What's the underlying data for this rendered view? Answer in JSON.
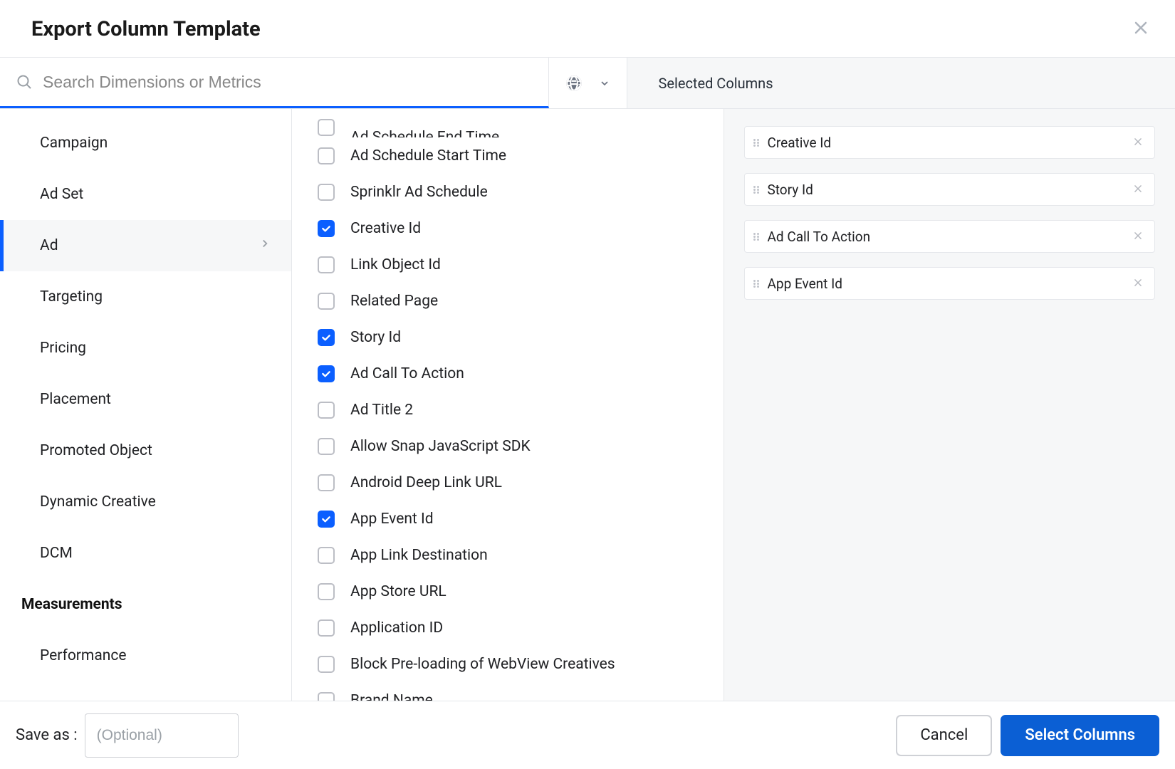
{
  "header": {
    "title": "Export Column Template"
  },
  "search": {
    "placeholder": "Search Dimensions or Metrics"
  },
  "selected_header": "Selected Columns",
  "sidebar": {
    "items": [
      {
        "label": "Campaign",
        "active": false
      },
      {
        "label": "Ad Set",
        "active": false
      },
      {
        "label": "Ad",
        "active": true
      },
      {
        "label": "Targeting",
        "active": false
      },
      {
        "label": "Pricing",
        "active": false
      },
      {
        "label": "Placement",
        "active": false
      },
      {
        "label": "Promoted Object",
        "active": false
      },
      {
        "label": "Dynamic Creative",
        "active": false
      },
      {
        "label": "DCM",
        "active": false
      }
    ],
    "section2": {
      "header": "Measurements",
      "items": [
        {
          "label": "Performance"
        }
      ]
    }
  },
  "options": [
    {
      "label": "Ad Schedule End Time",
      "checked": false,
      "cutoff": true
    },
    {
      "label": "Ad Schedule Start Time",
      "checked": false
    },
    {
      "label": "Sprinklr Ad Schedule",
      "checked": false
    },
    {
      "label": "Creative Id",
      "checked": true
    },
    {
      "label": "Link Object Id",
      "checked": false
    },
    {
      "label": "Related Page",
      "checked": false
    },
    {
      "label": "Story Id",
      "checked": true
    },
    {
      "label": "Ad Call To Action",
      "checked": true
    },
    {
      "label": "Ad Title 2",
      "checked": false
    },
    {
      "label": "Allow Snap JavaScript SDK",
      "checked": false
    },
    {
      "label": "Android Deep Link URL",
      "checked": false
    },
    {
      "label": "App Event Id",
      "checked": true
    },
    {
      "label": "App Link Destination",
      "checked": false
    },
    {
      "label": "App Store URL",
      "checked": false
    },
    {
      "label": "Application ID",
      "checked": false
    },
    {
      "label": "Block Pre-loading of WebView Creatives",
      "checked": false
    },
    {
      "label": "Brand Name",
      "checked": false
    }
  ],
  "selected": [
    {
      "label": "Creative Id"
    },
    {
      "label": "Story Id"
    },
    {
      "label": "Ad Call To Action"
    },
    {
      "label": "App Event Id"
    }
  ],
  "footer": {
    "saveas_label": "Save as :",
    "saveas_placeholder": "(Optional)",
    "cancel": "Cancel",
    "select": "Select Columns"
  }
}
